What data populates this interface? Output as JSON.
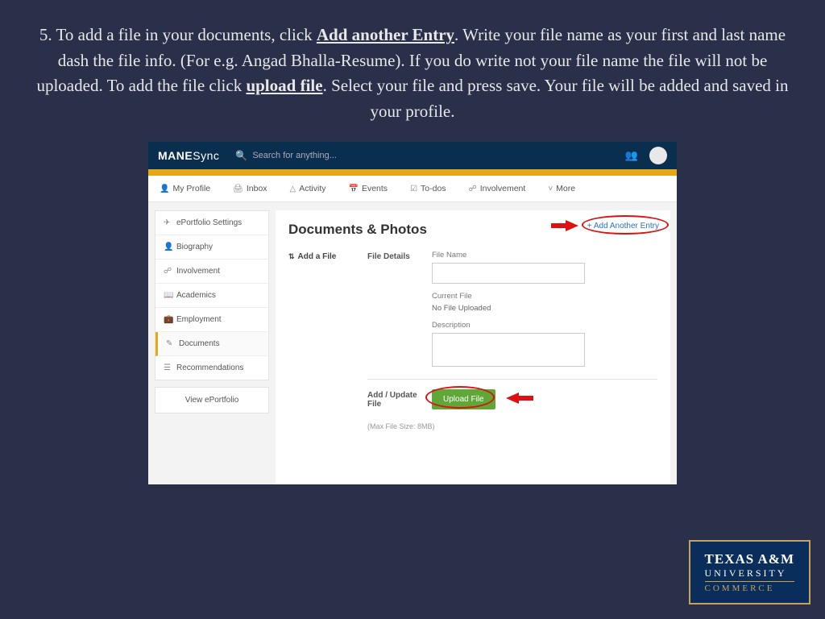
{
  "instruction": {
    "prefix": "5. To add a file in your documents, click ",
    "link1": "Add another Entry",
    "mid": ". Write your file name as your first and last name dash the file info. (For e.g. Angad Bhalla-Resume).  If you do write not your file name the file will not be uploaded. To add the file click ",
    "link2": "upload file",
    "suffix": ". Select your file and press save. Your file will be added and saved in your profile."
  },
  "header": {
    "brand_a": "MANE",
    "brand_b": "Sync",
    "search_placeholder": "Search for anything..."
  },
  "nav": {
    "profile": "My Profile",
    "inbox": "Inbox",
    "activity": "Activity",
    "events": "Events",
    "todos": "To-dos",
    "involvement": "Involvement",
    "more": "More"
  },
  "sidebar": {
    "items": [
      {
        "icon": "✈",
        "label": "ePortfolio Settings"
      },
      {
        "icon": "👤",
        "label": "Biography"
      },
      {
        "icon": "☍",
        "label": "Involvement"
      },
      {
        "icon": "📖",
        "label": "Academics"
      },
      {
        "icon": "💼",
        "label": "Employment"
      },
      {
        "icon": "✎",
        "label": "Documents"
      },
      {
        "icon": "☰",
        "label": "Recommendations"
      }
    ],
    "view": "View ePortfolio"
  },
  "main": {
    "title": "Documents & Photos",
    "add_entry": "+ Add Another Entry",
    "add_file": "Add a File",
    "file_details": "File Details",
    "file_name_label": "File Name",
    "current_file_label": "Current File",
    "current_file_value": "No File Uploaded",
    "description_label": "Description",
    "add_update_label": "Add / Update File",
    "upload_button": "Upload File",
    "max_hint": "(Max File Size: 8MB)"
  },
  "footer": {
    "l1": "TEXAS A&M",
    "l2": "UNIVERSITY",
    "l3": "COMMERCE"
  }
}
